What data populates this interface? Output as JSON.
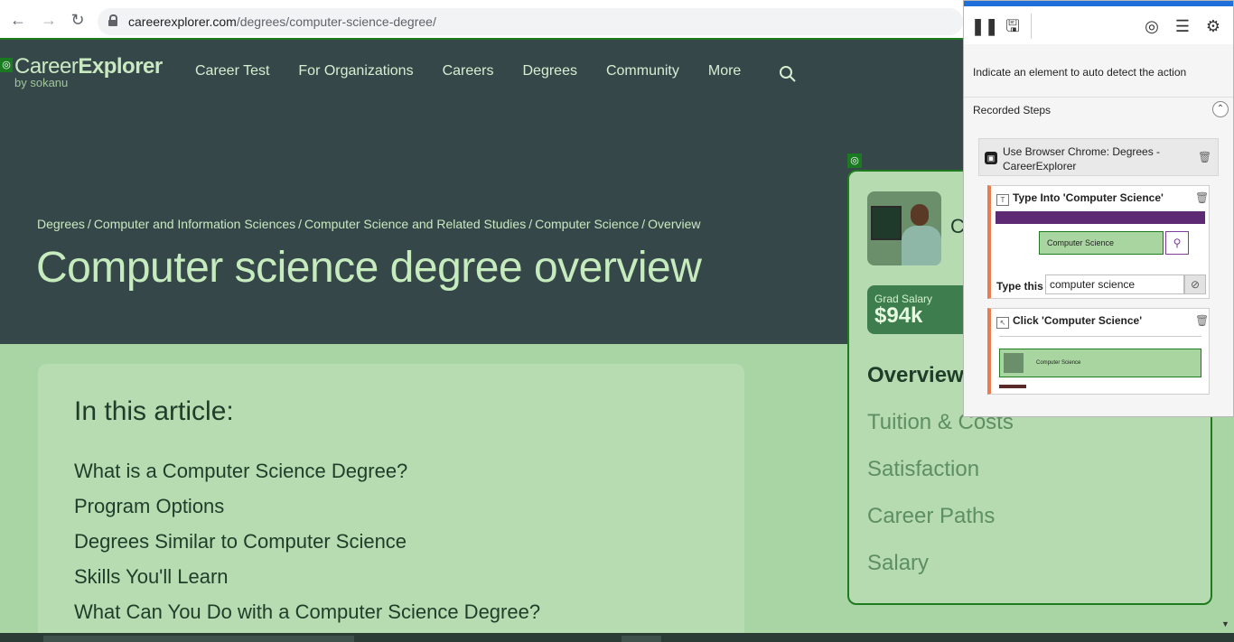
{
  "browser": {
    "url_domain": "careerexplorer.com",
    "url_path": "/degrees/computer-science-degree/"
  },
  "site": {
    "logo_main": "Career",
    "logo_bold": "Explorer",
    "logo_sub": "by sokanu",
    "nav": [
      "Career Test",
      "For Organizations",
      "Careers",
      "Degrees",
      "Community",
      "More"
    ]
  },
  "breadcrumb": [
    "Degrees",
    "Computer and Information Sciences",
    "Computer Science and Related Studies",
    "Computer Science",
    "Overview"
  ],
  "page_title": "Computer science degree overview",
  "article": {
    "toc_title": "In this article:",
    "toc": [
      "What is a Computer Science Degree?",
      "Program Options",
      "Degrees Similar to Computer Science",
      "Skills You'll Learn",
      "What Can You Do with a Computer Science Degree?"
    ]
  },
  "sidebar": {
    "name_initial": "C",
    "salary_label": "Grad Salary",
    "salary_value": "$94k",
    "links": [
      "Overview",
      "Tuition & Costs",
      "Satisfaction",
      "Career Paths",
      "Salary"
    ],
    "active": "Overview"
  },
  "recorder": {
    "hint": "Indicate an element to auto detect the action",
    "steps_title": "Recorded Steps",
    "browser_step": "Use Browser Chrome: Degrees - CareerExplorer",
    "type_step_title": "Type Into 'Computer Science'",
    "type_preview_text": "Computer Science",
    "type_label": "Type this",
    "type_value": "computer science",
    "click_step_title": "Click 'Computer Science'",
    "click_preview_text": "Computer Science"
  },
  "colors": {
    "hero_bg": "#36474a",
    "content_bg": "#a9d4a4",
    "accent_green": "#1e7c1e",
    "recorder_topbar": "#1e6fd9",
    "step_accent": "#e87b52"
  },
  "icons": {
    "back": "arrow-left-icon",
    "forward": "arrow-right-icon",
    "reload": "reload-icon",
    "lock": "lock-icon",
    "search": "search-icon",
    "pause": "pause-icon",
    "save": "save-icon",
    "target": "target-icon",
    "checklist": "checklist-icon",
    "settings": "gear-icon",
    "collapse": "chevron-up-icon",
    "delete": "trash-icon",
    "visibility": "eye-off-icon"
  }
}
